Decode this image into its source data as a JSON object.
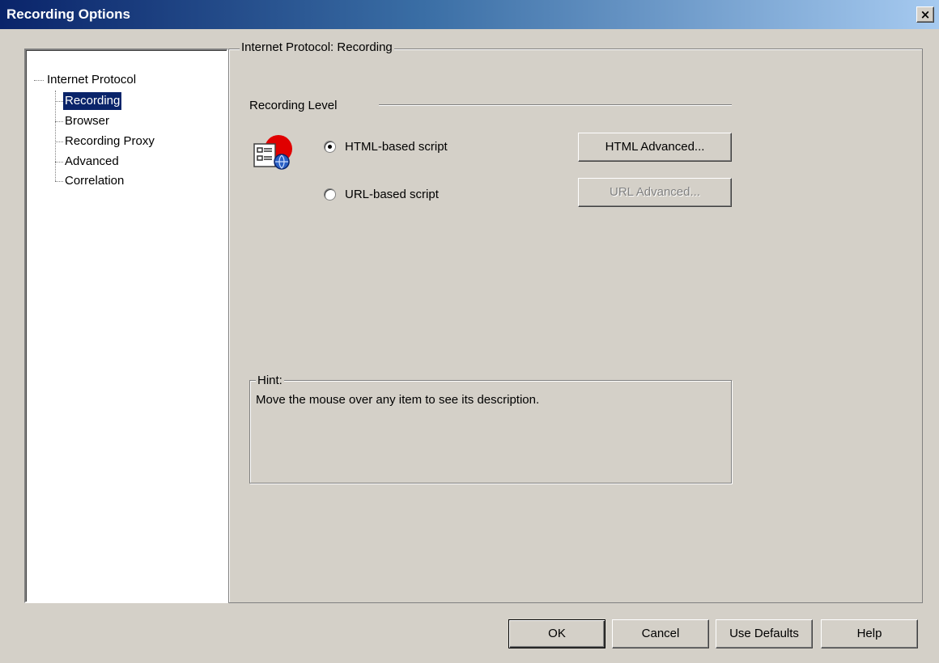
{
  "window": {
    "title": "Recording Options",
    "close_label": "×"
  },
  "tree": {
    "root": "Internet Protocol",
    "items": [
      {
        "label": "Recording",
        "selected": true
      },
      {
        "label": "Browser",
        "selected": false
      },
      {
        "label": "Recording Proxy",
        "selected": false
      },
      {
        "label": "Advanced",
        "selected": false
      },
      {
        "label": "Correlation",
        "selected": false
      }
    ]
  },
  "panel": {
    "title": "Internet Protocol: Recording",
    "section_label": "Recording Level",
    "icon": "recording-level-icon",
    "options": [
      {
        "label": "HTML-based script",
        "selected": true
      },
      {
        "label": "URL-based script",
        "selected": false
      }
    ],
    "html_advanced_label": "HTML Advanced...",
    "url_advanced_label": "URL Advanced..."
  },
  "hint": {
    "label": "Hint:",
    "text": "Move the mouse over any item to see its description."
  },
  "footer": {
    "ok_label": "OK",
    "cancel_label": "Cancel",
    "defaults_label": "Use Defaults",
    "help_label": "Help"
  },
  "colors": {
    "titlebar_start": "#0a246a",
    "titlebar_end": "#a6caf0",
    "face": "#d4d0c8",
    "selection": "#0a246a",
    "icon_red": "#e00000"
  }
}
